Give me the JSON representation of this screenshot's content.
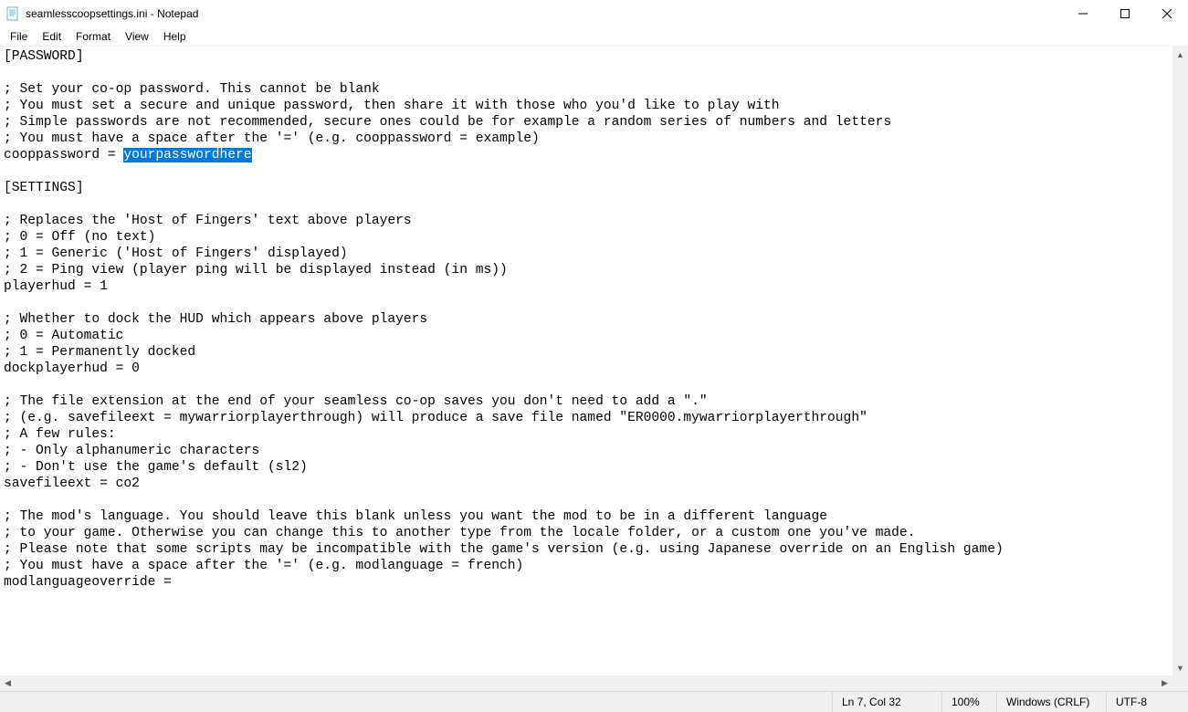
{
  "window": {
    "title": "seamlesscoopsettings.ini - Notepad"
  },
  "menu": {
    "file": "File",
    "edit": "Edit",
    "format": "Format",
    "view": "View",
    "help": "Help"
  },
  "editor": {
    "lines": [
      "[PASSWORD]",
      "",
      "; Set your co-op password. This cannot be blank",
      "; You must set a secure and unique password, then share it with those who you'd like to play with",
      "; Simple passwords are not recommended, secure ones could be for example a random series of numbers and letters",
      "; You must have a space after the '=' (e.g. cooppassword = example)",
      "cooppassword = ",
      "",
      "[SETTINGS]",
      "",
      "; Replaces the 'Host of Fingers' text above players",
      "; 0 = Off (no text)",
      "; 1 = Generic ('Host of Fingers' displayed)",
      "; 2 = Ping view (player ping will be displayed instead (in ms))",
      "playerhud = 1",
      "",
      "; Whether to dock the HUD which appears above players",
      "; 0 = Automatic",
      "; 1 = Permanently docked",
      "dockplayerhud = 0",
      "",
      "; The file extension at the end of your seamless co-op saves you don't need to add a \".\"",
      "; (e.g. savefileext = mywarriorplayerthrough) will produce a save file named \"ER0000.mywarriorplayerthrough\"",
      "; A few rules:",
      "; - Only alphanumeric characters",
      "; - Don't use the game's default (sl2)",
      "savefileext = co2",
      "",
      "; The mod's language. You should leave this blank unless you want the mod to be in a different language",
      "; to your game. Otherwise you can change this to another type from the locale folder, or a custom one you've made.",
      "; Please note that some scripts may be incompatible with the game's version (e.g. using Japanese override on an English game)",
      "; You must have a space after the '=' (e.g. modlanguage = french)",
      "modlanguageoverride = "
    ],
    "selection": {
      "line_index": 6,
      "text": "yourpasswordhere"
    }
  },
  "status": {
    "position": "Ln 7, Col 32",
    "zoom": "100%",
    "line_ending": "Windows (CRLF)",
    "encoding": "UTF-8"
  }
}
